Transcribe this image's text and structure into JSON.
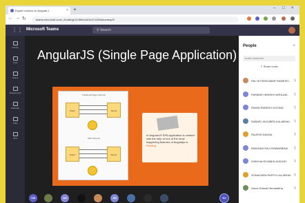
{
  "browser": {
    "tab_title": "Expert Lecture on Angular J",
    "tab_close": "×",
    "new_tab": "+",
    "window_controls": [
      "–",
      "□",
      "×"
    ],
    "url": "teams.microsoft.com/_#/calling/19:8f9e0d21b471289d/meetup/0",
    "nav": [
      "←",
      "→",
      "↻"
    ]
  },
  "teams": {
    "app_title": "Microsoft Teams",
    "search_placeholder": "Search",
    "waffle": "⋮⋮"
  },
  "rail": [
    {
      "label": "Activity"
    },
    {
      "label": "Chat"
    },
    {
      "label": "Teams"
    },
    {
      "label": "Assignments"
    },
    {
      "label": "Calendar"
    },
    {
      "label": "Calls"
    },
    {
      "label": "Files"
    }
  ],
  "slide": {
    "title": "AngularJS (Single Page Application)",
    "diagram_top_caption": "Traditional Page Lifecycle",
    "diagram_bottom_caption": "SPA Lifecycle",
    "box_client": "Client",
    "box_server": "Server",
    "bubble_text": "In AngularJS SPA application is created with the help of one of the most happening features of Angularjs is ",
    "bubble_highlight": "Routing"
  },
  "participants": [
    {
      "initials": "+20",
      "color": "#5b5fc7"
    },
    {
      "initials": "",
      "color": "#6d7a4a"
    },
    {
      "initials": "AS",
      "color": "#7f86d6"
    },
    {
      "initials": "",
      "color": "#111111"
    },
    {
      "initials": "",
      "color": "#c98a5a"
    },
    {
      "initials": "JM",
      "color": "#7f86d6"
    },
    {
      "initials": "",
      "color": "#4a6fa5"
    },
    {
      "initials": "",
      "color": "#2b2b2b"
    },
    {
      "initials": "",
      "color": "#3b4d6b"
    },
    {
      "initials": "HJ",
      "color": "#4b53bc"
    }
  ],
  "people": {
    "title": "People",
    "close": "×",
    "invite_placeholder": "Invite someone",
    "share_invite": "Share invite",
    "list": [
      {
        "name": "PAL NITISHKUMAR RAMESH...",
        "color": "#c98a5a"
      },
      {
        "name": "PARMAR HENSHI HARILAM...",
        "color": "#7f86d6"
      },
      {
        "name": "PAVAN PARESH GOVIND",
        "color": "#7f86d6"
      },
      {
        "name": "RABARI JAGUBEN KALABHAI",
        "color": "#5a7fa8"
      },
      {
        "name": "RAJESH DAVDA",
        "color": "#e0a030"
      },
      {
        "name": "RANGANI RAJ ISHWARBHAI",
        "color": "#7f86d6"
      },
      {
        "name": "SHEKHA RIYABEN KISHOR",
        "color": "#7f86d6"
      },
      {
        "name": "SONAGARA PARTH LALJIBHAI",
        "color": "#e0a030"
      },
      {
        "name": "Veera Dhaval Hemantbha",
        "color": "#6a8f5a"
      }
    ]
  }
}
